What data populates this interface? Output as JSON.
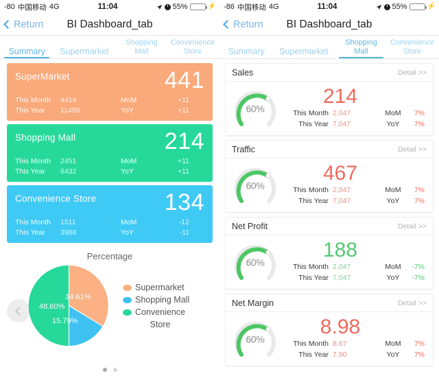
{
  "screens": [
    {
      "id": "left",
      "statusbar": {
        "signal": "-80",
        "carrier": "中国移动",
        "network": "4G",
        "time": "11:04",
        "battery_percent": "55%",
        "battery_level": 55,
        "icons": [
          "location-arrow-icon",
          "alarm-icon",
          "battery-icon",
          "charging-bolt-icon"
        ]
      },
      "navbar": {
        "back_label": "Return",
        "title": "BI Dashboard_tab"
      },
      "tabs": [
        {
          "label": "Summary",
          "active": true
        },
        {
          "label": "Supermarket",
          "active": false
        },
        {
          "label": "Shopping\nMall",
          "active": false
        },
        {
          "label": "Convenience\nStore",
          "active": false
        }
      ]
    },
    {
      "id": "right",
      "statusbar": {
        "signal": "-86",
        "carrier": "中国移动",
        "network": "4G",
        "time": "11:04",
        "battery_percent": "55%",
        "battery_level": 55,
        "icons": [
          "location-arrow-icon",
          "alarm-icon",
          "battery-icon",
          "charging-bolt-icon"
        ]
      },
      "navbar": {
        "back_label": "Return",
        "title": "BI Dashboard_tab"
      },
      "tabs": [
        {
          "label": "Summary",
          "active": false
        },
        {
          "label": "Supermarket",
          "active": false
        },
        {
          "label": "Shopping\nMall",
          "active": true
        },
        {
          "label": "Convenience\nStore",
          "active": false
        }
      ]
    }
  ],
  "summary_cards": [
    {
      "name": "SuperMarket",
      "value": "441",
      "color": "#f9a97a",
      "this_month_label": "This Month",
      "this_month_value": "4414",
      "this_year_label": "This Year",
      "this_year_value": "11456",
      "mom_label": "MoM",
      "mom_value": "+11",
      "yoy_label": "YoY",
      "yoy_value": "+11"
    },
    {
      "name": "Shopping Mall",
      "value": "214",
      "color": "#26d99a",
      "this_month_label": "This Month",
      "this_month_value": "2451",
      "this_year_label": "This Year",
      "this_year_value": "6432",
      "mom_label": "MoM",
      "mom_value": "+11",
      "yoy_label": "YoY",
      "yoy_value": "+11"
    },
    {
      "name": "Convenience Store",
      "value": "134",
      "color": "#3fc9f5",
      "this_month_label": "This Month",
      "this_month_value": "1511",
      "this_year_label": "This Year",
      "this_year_value": "3988",
      "mom_label": "MoM",
      "mom_value": "-12",
      "yoy_label": "YoY",
      "yoy_value": "-11"
    }
  ],
  "pie_panel": {
    "title": "Percentage",
    "prev_button_icon": "chevron-left-icon",
    "page_dots": 2,
    "active_dot": 0
  },
  "chart_data": {
    "type": "pie",
    "title": "Percentage",
    "categories": [
      "Supermarket",
      "Shopping Mall",
      "Convenience Store"
    ],
    "values": [
      34.61,
      15.79,
      48.6
    ],
    "labels": [
      "34.61%",
      "15.79%",
      "48.60%"
    ],
    "colors": [
      "#fbb183",
      "#3fc2f2",
      "#26d99a"
    ],
    "legend": [
      "Supermarket",
      "Shopping Mall",
      "Convenience\nStore"
    ],
    "legend_position": "right",
    "start_angle_deg": 0,
    "grid": false
  },
  "detail_cards": [
    {
      "title": "Sales",
      "detail_label": "Detail >>",
      "gauge_percent": "60%",
      "gauge_value": 60,
      "gauge_color": "#4cc764",
      "big_value": "214",
      "value_color": "#ef6a5e",
      "this_month_label": "This Month",
      "this_month_value": "2,047",
      "this_year_label": "This Year",
      "this_year_value": "7,047",
      "mom_label": "MoM",
      "mom_value": "7%",
      "yoy_label": "YoY",
      "yoy_value": "7%"
    },
    {
      "title": "Traffic",
      "detail_label": "Detail >>",
      "gauge_percent": "60%",
      "gauge_value": 60,
      "gauge_color": "#4cc764",
      "big_value": "467",
      "value_color": "#ef6a5e",
      "this_month_label": "This Month",
      "this_month_value": "2,047",
      "this_year_label": "This Year",
      "this_year_value": "7,047",
      "mom_label": "MoM",
      "mom_value": "7%",
      "yoy_label": "YoY",
      "yoy_value": "7%"
    },
    {
      "title": "Net Profit",
      "detail_label": "Detail >>",
      "gauge_percent": "60%",
      "gauge_value": 60,
      "gauge_color": "#4cc764",
      "big_value": "188",
      "value_color": "#56c871",
      "this_month_label": "This Month",
      "this_month_value": "2,047",
      "this_year_label": "This Year",
      "this_year_value": "7,047",
      "mom_label": "MoM",
      "mom_value": "-7%",
      "yoy_label": "YoY",
      "yoy_value": "-7%"
    },
    {
      "title": "Net Margin",
      "detail_label": "Detail >>",
      "gauge_percent": "60%",
      "gauge_value": 60,
      "gauge_color": "#4cc764",
      "big_value": "8.98",
      "value_color": "#ef6a5e",
      "this_month_label": "This Month",
      "this_month_value": "8.67",
      "this_year_label": "This Year",
      "this_year_value": "7.90",
      "mom_label": "MoM",
      "mom_value": "7%",
      "yoy_label": "YoY",
      "yoy_value": "7%"
    }
  ]
}
